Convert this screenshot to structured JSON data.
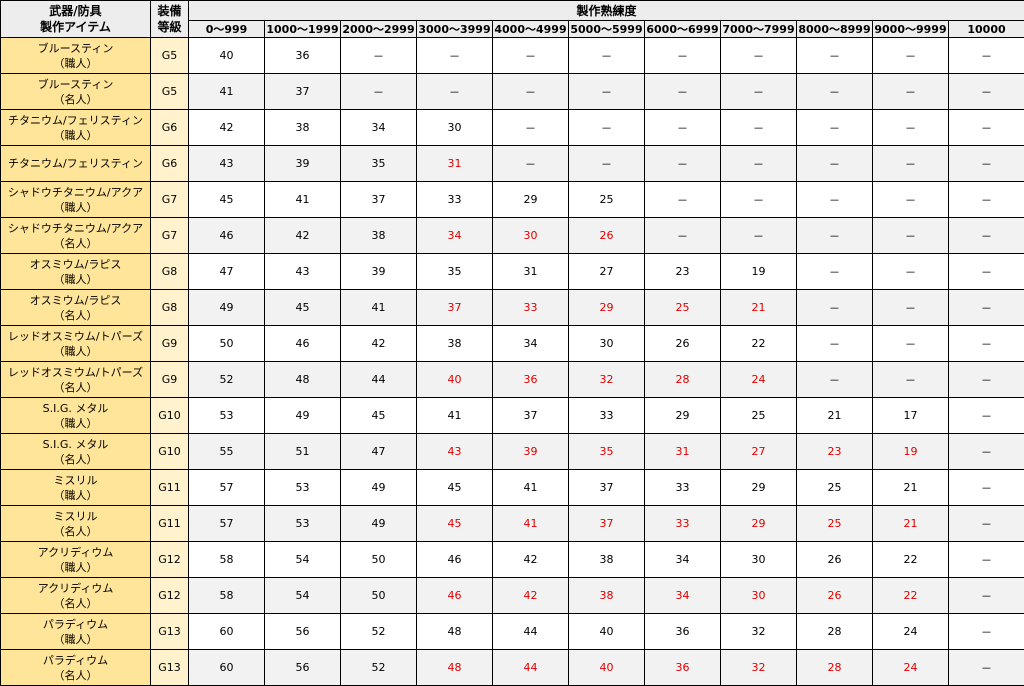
{
  "header": {
    "item_col": [
      "武器/防具",
      "製作アイテム"
    ],
    "grade_col": [
      "装備",
      "等級"
    ],
    "skill_group": "製作熟練度",
    "ranges": [
      "0～999",
      "1000～1999",
      "2000～2999",
      "3000～3999",
      "4000～4999",
      "5000～5999",
      "6000～6999",
      "7000～7999",
      "8000～8999",
      "9000～9999",
      "10000"
    ]
  },
  "colors": {
    "item_bg": "#ffe599",
    "grade_bg": "#fff2cc",
    "header_bg": "#ededed",
    "alt_row_bg": "#f2f2f2",
    "highlight_text": "#e00000"
  },
  "rows": [
    {
      "name": "ブルースティン",
      "role": "（職人）",
      "grade": "G5",
      "values": [
        "40",
        "36",
        "－",
        "－",
        "－",
        "－",
        "－",
        "－",
        "－",
        "－",
        "－"
      ],
      "red": []
    },
    {
      "name": "ブルースティン",
      "role": "（名人）",
      "grade": "G5",
      "values": [
        "41",
        "37",
        "－",
        "－",
        "－",
        "－",
        "－",
        "－",
        "－",
        "－",
        "－"
      ],
      "red": []
    },
    {
      "name": "チタニウム/フェリスティン",
      "role": "（職人）",
      "grade": "G6",
      "values": [
        "42",
        "38",
        "34",
        "30",
        "－",
        "－",
        "－",
        "－",
        "－",
        "－",
        "－"
      ],
      "red": []
    },
    {
      "name": "チタニウム/フェリスティン",
      "role": "",
      "grade": "G6",
      "values": [
        "43",
        "39",
        "35",
        "31",
        "－",
        "－",
        "－",
        "－",
        "－",
        "－",
        "－"
      ],
      "red": [
        3
      ]
    },
    {
      "name": "シャドウチタニウム/アクア",
      "role": "（職人）",
      "grade": "G7",
      "values": [
        "45",
        "41",
        "37",
        "33",
        "29",
        "25",
        "－",
        "－",
        "－",
        "－",
        "－"
      ],
      "red": []
    },
    {
      "name": "シャドウチタニウム/アクア",
      "role": "（名人）",
      "grade": "G7",
      "values": [
        "46",
        "42",
        "38",
        "34",
        "30",
        "26",
        "－",
        "－",
        "－",
        "－",
        "－"
      ],
      "red": [
        3,
        4,
        5
      ]
    },
    {
      "name": "オスミウム/ラピス",
      "role": "（職人）",
      "grade": "G8",
      "values": [
        "47",
        "43",
        "39",
        "35",
        "31",
        "27",
        "23",
        "19",
        "－",
        "－",
        "－"
      ],
      "red": []
    },
    {
      "name": "オスミウム/ラピス",
      "role": "（名人）",
      "grade": "G8",
      "values": [
        "49",
        "45",
        "41",
        "37",
        "33",
        "29",
        "25",
        "21",
        "－",
        "－",
        "－"
      ],
      "red": [
        3,
        4,
        5,
        6,
        7
      ]
    },
    {
      "name": "レッドオスミウム/トパーズ",
      "role": "（職人）",
      "grade": "G9",
      "values": [
        "50",
        "46",
        "42",
        "38",
        "34",
        "30",
        "26",
        "22",
        "－",
        "－",
        "－"
      ],
      "red": []
    },
    {
      "name": "レッドオスミウム/トパーズ",
      "role": "（名人）",
      "grade": "G9",
      "values": [
        "52",
        "48",
        "44",
        "40",
        "36",
        "32",
        "28",
        "24",
        "－",
        "－",
        "－"
      ],
      "red": [
        3,
        4,
        5,
        6,
        7
      ]
    },
    {
      "name": "S.I.G. メタル",
      "role": "（職人）",
      "grade": "G10",
      "values": [
        "53",
        "49",
        "45",
        "41",
        "37",
        "33",
        "29",
        "25",
        "21",
        "17",
        "－"
      ],
      "red": []
    },
    {
      "name": "S.I.G. メタル",
      "role": "（名人）",
      "grade": "G10",
      "values": [
        "55",
        "51",
        "47",
        "43",
        "39",
        "35",
        "31",
        "27",
        "23",
        "19",
        "－"
      ],
      "red": [
        3,
        4,
        5,
        6,
        7,
        8,
        9
      ]
    },
    {
      "name": "ミスリル",
      "role": "（職人）",
      "grade": "G11",
      "values": [
        "57",
        "53",
        "49",
        "45",
        "41",
        "37",
        "33",
        "29",
        "25",
        "21",
        "－"
      ],
      "red": []
    },
    {
      "name": "ミスリル",
      "role": "（名人）",
      "grade": "G11",
      "values": [
        "57",
        "53",
        "49",
        "45",
        "41",
        "37",
        "33",
        "29",
        "25",
        "21",
        "－"
      ],
      "red": [
        3,
        4,
        5,
        6,
        7,
        8,
        9
      ]
    },
    {
      "name": "アクリディウム",
      "role": "（職人）",
      "grade": "G12",
      "values": [
        "58",
        "54",
        "50",
        "46",
        "42",
        "38",
        "34",
        "30",
        "26",
        "22",
        "－"
      ],
      "red": []
    },
    {
      "name": "アクリディウム",
      "role": "（名人）",
      "grade": "G12",
      "values": [
        "58",
        "54",
        "50",
        "46",
        "42",
        "38",
        "34",
        "30",
        "26",
        "22",
        "－"
      ],
      "red": [
        3,
        4,
        5,
        6,
        7,
        8,
        9
      ]
    },
    {
      "name": "パラディウム",
      "role": "（職人）",
      "grade": "G13",
      "values": [
        "60",
        "56",
        "52",
        "48",
        "44",
        "40",
        "36",
        "32",
        "28",
        "24",
        "－"
      ],
      "red": []
    },
    {
      "name": "パラディウム",
      "role": "（名人）",
      "grade": "G13",
      "values": [
        "60",
        "56",
        "52",
        "48",
        "44",
        "40",
        "36",
        "32",
        "28",
        "24",
        "－"
      ],
      "red": [
        3,
        4,
        5,
        6,
        7,
        8,
        9
      ]
    }
  ]
}
